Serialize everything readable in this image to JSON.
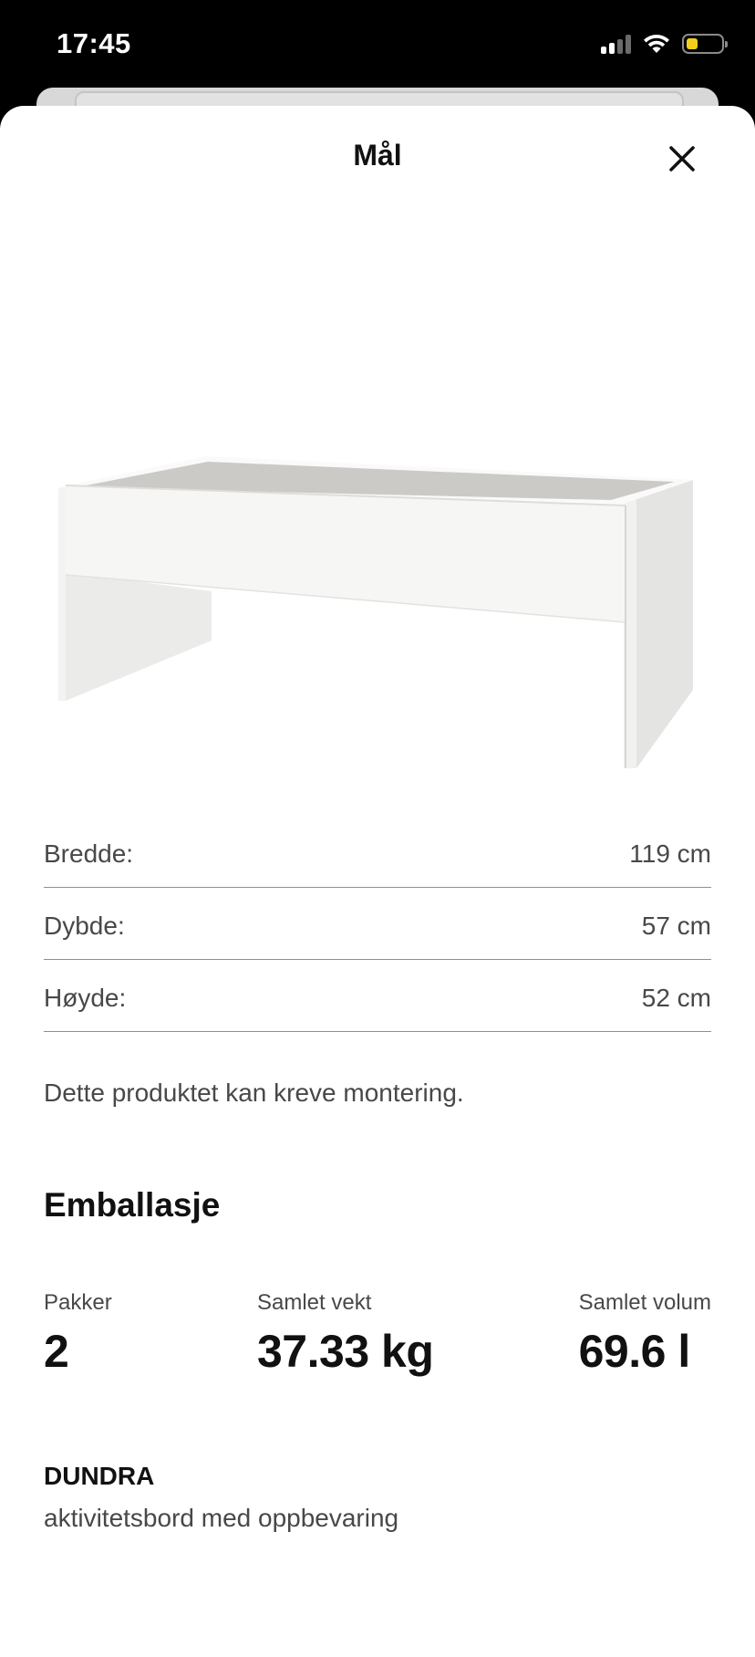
{
  "status_bar": {
    "time": "17:45",
    "battery_color": "#f2cf1b"
  },
  "sheet": {
    "title": "Mål",
    "close_icon": "close-icon"
  },
  "product_image": {
    "description_icon": "table-image"
  },
  "dimensions": [
    {
      "label": "Bredde:",
      "value": "119 cm"
    },
    {
      "label": "Dybde:",
      "value": "57 cm"
    },
    {
      "label": "Høyde:",
      "value": "52 cm"
    }
  ],
  "assembly_note": "Dette produktet kan kreve montering.",
  "packaging": {
    "heading": "Emballasje",
    "stats": [
      {
        "label": "Pakker",
        "value": "2"
      },
      {
        "label": "Samlet vekt",
        "value": "37.33 kg"
      },
      {
        "label": "Samlet volum",
        "value": "69.6 l"
      }
    ]
  },
  "product": {
    "name": "DUNDRA",
    "description": "aktivitetsbord med oppbevaring"
  }
}
